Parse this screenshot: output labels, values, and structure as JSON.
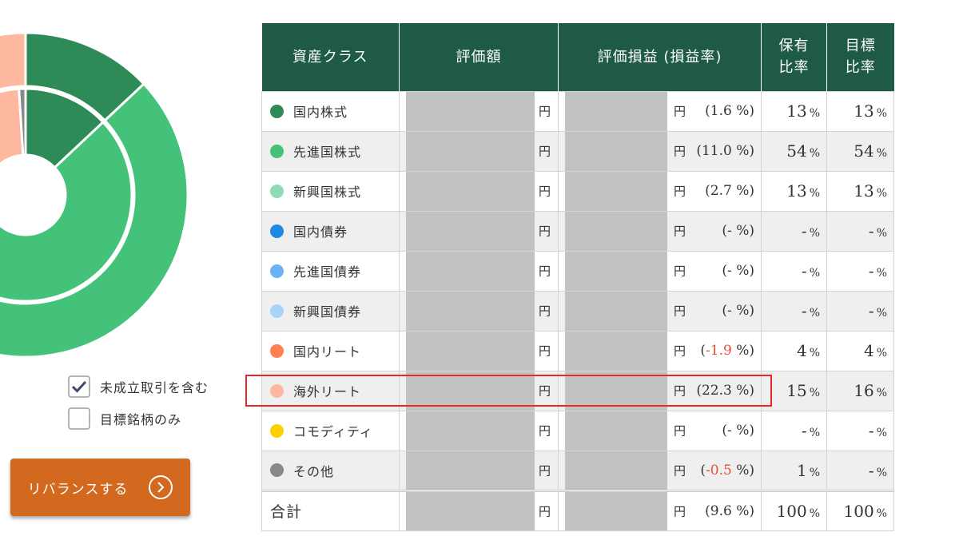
{
  "chart_data": {
    "type": "pie",
    "outer": {
      "name": "",
      "categories": [
        "国内株式",
        "先進国株式",
        "新興国株式",
        "国内債券",
        "先進国債券",
        "新興国債券",
        "国内リート",
        "海外リート",
        "コモディティ",
        "その他"
      ],
      "values": [
        13,
        54,
        13,
        0,
        0,
        0,
        4,
        16,
        0,
        0
      ]
    },
    "inner": {
      "name": "",
      "categories": [
        "国内株式",
        "先進国株式",
        "新興国株式",
        "国内債券",
        "先進国債券",
        "新興国債券",
        "国内リート",
        "海外リート",
        "コモディティ",
        "その他"
      ],
      "values": [
        13,
        54,
        13,
        0,
        0,
        0,
        4,
        15,
        0,
        1
      ]
    },
    "colors": [
      "#2e8b57",
      "#44c27a",
      "#8fdcb4",
      "#1e88e5",
      "#6bb1f7",
      "#a8d3fb",
      "#ff7f50",
      "#ffb8a0",
      "#ffd000",
      "#888888"
    ]
  },
  "options": {
    "include_pending": {
      "label": "未成立取引を含む",
      "checked": true
    },
    "target_only": {
      "label": "目標銘柄のみ",
      "checked": false
    }
  },
  "rebalance_button": {
    "label": "リバランスする",
    "icon": "chevron-right-icon"
  },
  "table": {
    "headers": {
      "asset_class": "資産クラス",
      "valuation": "評価額",
      "pl": "評価損益 (損益率)",
      "holding_ratio": "保有\n比率",
      "target_ratio": "目標\n比率"
    },
    "yen": "円",
    "pct": "%",
    "rows": [
      {
        "name": "国内株式",
        "color": "#2e8b57",
        "pl": "(1.6 %)",
        "holding": "13",
        "target": "13"
      },
      {
        "name": "先進国株式",
        "color": "#44c27a",
        "pl": "(11.0 %)",
        "holding": "54",
        "target": "54"
      },
      {
        "name": "新興国株式",
        "color": "#8fdcb4",
        "pl": "(2.7 %)",
        "holding": "13",
        "target": "13"
      },
      {
        "name": "国内債券",
        "color": "#1e88e5",
        "pl": "(- %)",
        "holding": "-",
        "target": "-"
      },
      {
        "name": "先進国債券",
        "color": "#6bb1f7",
        "pl": "(- %)",
        "holding": "-",
        "target": "-"
      },
      {
        "name": "新興国債券",
        "color": "#a8d3fb",
        "pl": "(- %)",
        "holding": "-",
        "target": "-"
      },
      {
        "name": "国内リート",
        "color": "#ff7f50",
        "pl_open": "(",
        "pl_neg": "-1.9",
        "pl_close": " %)",
        "holding": "4",
        "target": "4"
      },
      {
        "name": "海外リート",
        "color": "#ffb8a0",
        "pl": "(22.3 %)",
        "holding": "15",
        "target": "16"
      },
      {
        "name": "コモディティ",
        "color": "#ffd000",
        "pl": "(- %)",
        "holding": "-",
        "target": "-"
      },
      {
        "name": "その他",
        "color": "#888888",
        "pl_open": "(",
        "pl_neg": "-0.5",
        "pl_close": " %)",
        "holding": "1",
        "target": "-"
      }
    ],
    "total": {
      "name": "合計",
      "pl": "(9.6 %)",
      "holding": "100",
      "target": "100"
    }
  }
}
